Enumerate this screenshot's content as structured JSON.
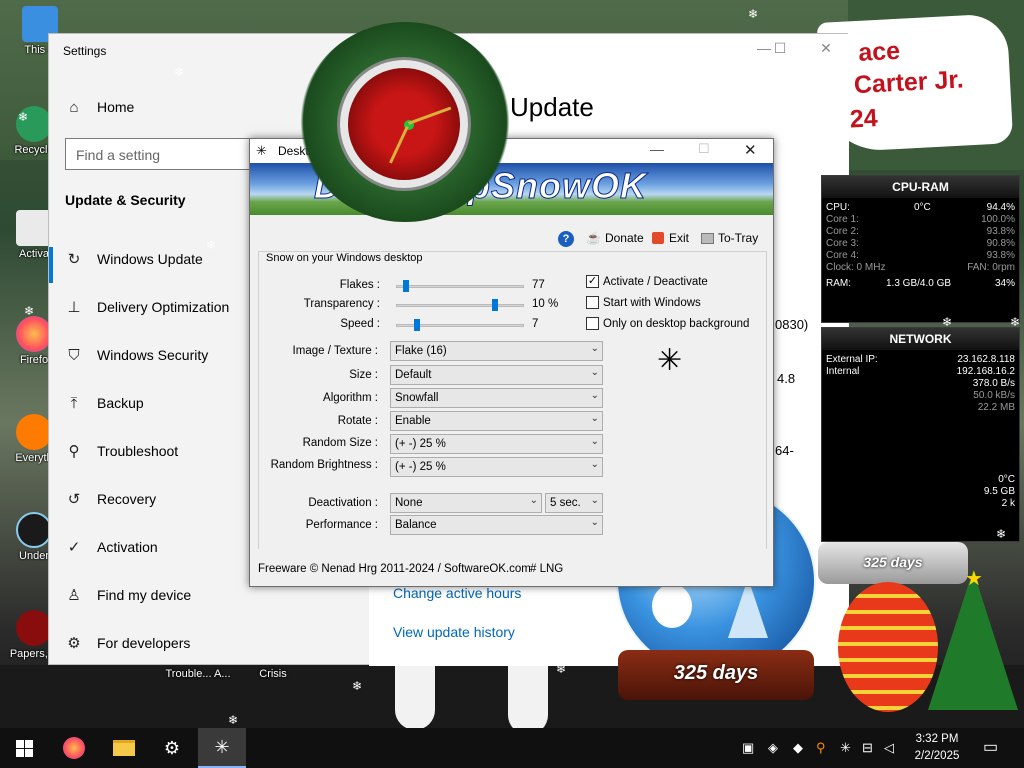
{
  "desktop": {
    "icons": [
      {
        "label": "This P",
        "icon": "this-pc-icon"
      },
      {
        "label": "Recycle",
        "icon": "recycle-bin-icon"
      },
      {
        "label": "Activa",
        "icon": "activate-icon"
      },
      {
        "label": "Firefo",
        "icon": "firefox-icon"
      },
      {
        "label": "Everyth",
        "icon": "everything-icon"
      },
      {
        "label": "Under",
        "icon": "undertale-icon"
      },
      {
        "label": "Papers, P",
        "icon": "papers-please-icon"
      }
    ],
    "bottom_labels": [
      "Trouble... A...",
      "Crisis"
    ],
    "banner_lines": [
      "ace",
      "l Carter Jr.",
      "24"
    ]
  },
  "settings": {
    "window_title": "Settings",
    "home": "Home",
    "search_placeholder": "Find a setting",
    "section": "Update & Security",
    "nav": [
      {
        "label": "Windows Update",
        "icon": "refresh-icon"
      },
      {
        "label": "Delivery Optimization",
        "icon": "delivery-optimization-icon"
      },
      {
        "label": "Windows Security",
        "icon": "shield-icon"
      },
      {
        "label": "Backup",
        "icon": "backup-arrow-icon"
      },
      {
        "label": "Troubleshoot",
        "icon": "wrench-icon"
      },
      {
        "label": "Recovery",
        "icon": "recovery-icon"
      },
      {
        "label": "Activation",
        "icon": "check-circle-icon"
      },
      {
        "label": "Find my device",
        "icon": "person-pin-icon"
      },
      {
        "label": "For developers",
        "icon": "developer-icon"
      }
    ],
    "page_title": "Update",
    "links": [
      "Change active hours",
      "View update history"
    ],
    "partial_texts": [
      "0830)",
      "4.8",
      "64-"
    ],
    "window_controls": {
      "minimize": "—",
      "maximize": "☐",
      "close": "✕"
    }
  },
  "dsnow": {
    "title": "DesktopSnowOK",
    "title_visible": "Desktop",
    "brand": "DesktopSnowOK",
    "brand_visible": "pSnowOK",
    "brand_prefix_visible": "D",
    "toolbar": {
      "help": "?",
      "donate": "Donate",
      "exit": "Exit",
      "tray": "To-Tray"
    },
    "group_label": "Snow on your Windows desktop",
    "sliders": [
      {
        "label": "Flakes :",
        "value_text": "77",
        "position": 0.05
      },
      {
        "label": "Transparency :",
        "value_text": "10 %",
        "position": 0.78
      },
      {
        "label": "Speed :",
        "value_text": "7",
        "position": 0.14
      }
    ],
    "checkboxes": [
      {
        "label": "Activate / Deactivate",
        "checked": true
      },
      {
        "label": "Start with Windows",
        "checked": false
      },
      {
        "label": "Only on desktop background",
        "checked": false
      }
    ],
    "combos": [
      {
        "label": "Image / Texture :",
        "value": "Flake (16)"
      },
      {
        "label": "Size :",
        "value": "Default"
      },
      {
        "label": "Algorithm :",
        "value": "Snowfall"
      },
      {
        "label": "Rotate :",
        "value": "Enable"
      },
      {
        "label": "Random Size :",
        "value": "(+ -) 25 %"
      },
      {
        "label": "Random Brightness :",
        "value": "(+ -) 25 %"
      }
    ],
    "deactivation": {
      "label": "Deactivation :",
      "value": "None",
      "time": "5 sec."
    },
    "performance": {
      "label": "Performance :",
      "value": "Balance"
    },
    "footer": {
      "copyright": "Freeware © Nenad Hrg 2011-2024 / SoftwareOK.com",
      "lng": "# LNG"
    }
  },
  "cpu_ram": {
    "title": "CPU-RAM",
    "cpu": {
      "label": "CPU:",
      "temp": "0°C",
      "value": "94.4%"
    },
    "cores": [
      {
        "label": "Core 1:",
        "value": "100.0%"
      },
      {
        "label": "Core 2:",
        "value": "93.8%"
      },
      {
        "label": "Core 3:",
        "value": "90.8%"
      },
      {
        "label": "Core 4:",
        "value": "93.8%"
      }
    ],
    "clock": {
      "label": "Clock: 0 MHz",
      "fan": "FAN: 0rpm"
    },
    "ram": {
      "label": "RAM:",
      "usage": "1.3 GB/4.0 GB",
      "value": "34%"
    }
  },
  "network": {
    "title": "NETWORK",
    "external_ip": {
      "label": "External IP:",
      "value": "23.162.8.118"
    },
    "internal_ip": {
      "label": "Internal",
      "value": "192.168.16.2"
    },
    "values": [
      "378.0 B/s",
      "50.0 kB/s",
      "22.2 MB"
    ],
    "extra": [
      "0°C",
      "9.5 GB",
      "2 k"
    ]
  },
  "globes": [
    {
      "days": "325 days"
    },
    {
      "days": "325 days"
    }
  ],
  "taskbar": {
    "apps": [
      {
        "name": "start-button",
        "icon": "windows-logo-icon"
      },
      {
        "name": "firefox",
        "icon": "firefox-icon"
      },
      {
        "name": "file-explorer",
        "icon": "folder-icon"
      },
      {
        "name": "settings",
        "icon": "gear-icon"
      },
      {
        "name": "desktopsnowok",
        "icon": "snowflake-icon"
      }
    ],
    "time": "3:32 PM",
    "date": "2/2/2025"
  }
}
